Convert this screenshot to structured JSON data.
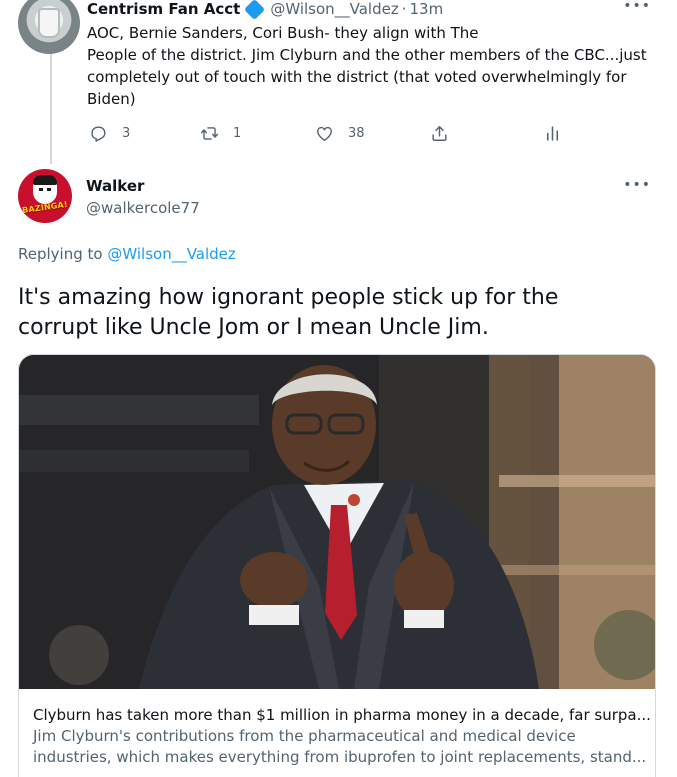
{
  "parent_tweet": {
    "display_name": "Centrism Fan Acct",
    "handle": "@Wilson__Valdez",
    "separator": "·",
    "time": "13m",
    "more": "•••",
    "text_lines": [
      "AOC, Bernie Sanders, Cori Bush- they align with The",
      "People of the district.  Jim Clyburn and the other members of the CBC...just",
      "completely out of touch with the district (that voted overwhelmingly for",
      "Biden)"
    ],
    "actions": {
      "reply_count": "3",
      "retweet_count": "1",
      "like_count": "38"
    }
  },
  "main_tweet": {
    "display_name": "Walker",
    "handle": "@walkercole77",
    "avatar_text": "BAZINGA!",
    "more": "•••",
    "replying_prefix": "Replying to",
    "replying_to": "@Wilson__Valdez",
    "text_lines": [
      "It's amazing how ignorant people stick up for the",
      "corrupt like Uncle Jom or I mean Uncle Jim."
    ],
    "card": {
      "title": "Clyburn has taken more than $1 million in pharma money in a decade, far surpa...",
      "description_lines": [
        "Jim Clyburn's contributions from the pharmaceutical and medical device",
        "industries, which makes everything from ibuprofen to joint replacements, stand..."
      ]
    }
  },
  "icons": [
    "reply-icon",
    "retweet-icon",
    "like-icon",
    "share-icon",
    "analytics-icon",
    "more-icon",
    "verified-badge-icon"
  ],
  "colors": {
    "accent": "#1d9bf0",
    "text": "#0f1419",
    "secondary": "#536471",
    "border": "#cfd9de",
    "avatar_red": "#c8102e"
  }
}
